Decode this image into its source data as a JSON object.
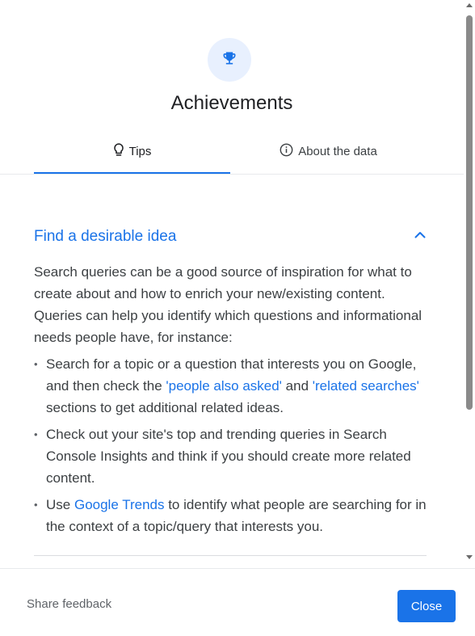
{
  "dialog": {
    "title": "Achievements",
    "icon": "trophy-icon",
    "accent_color": "#1a73e8"
  },
  "tabs": [
    {
      "label": "Tips",
      "icon": "lightbulb-icon",
      "active": true
    },
    {
      "label": "About the data",
      "icon": "info-icon",
      "active": false
    }
  ],
  "section": {
    "title": "Find a desirable idea",
    "expanded": true,
    "intro": "Search queries can be a good source of inspiration for what to create about and how to enrich your new/existing content. Queries can help you identify which questions and informational needs people have, for instance:",
    "bullet1": {
      "before": "Search for a topic or a question that interests you on Google, and then check the ",
      "link1": "'people also asked'",
      "middle": " and ",
      "link2": "'related searches'",
      "after": " sections to get additional related ideas."
    },
    "bullet2": {
      "text": "Check out your site's top and trending queries in Search Console Insights and think if you should create more related content."
    },
    "bullet3": {
      "before": "Use ",
      "link": "Google Trends",
      "after": " to identify what people are searching for in the context of a topic/query that interests you."
    }
  },
  "footer": {
    "share_feedback": "Share feedback",
    "close_label": "Close"
  }
}
